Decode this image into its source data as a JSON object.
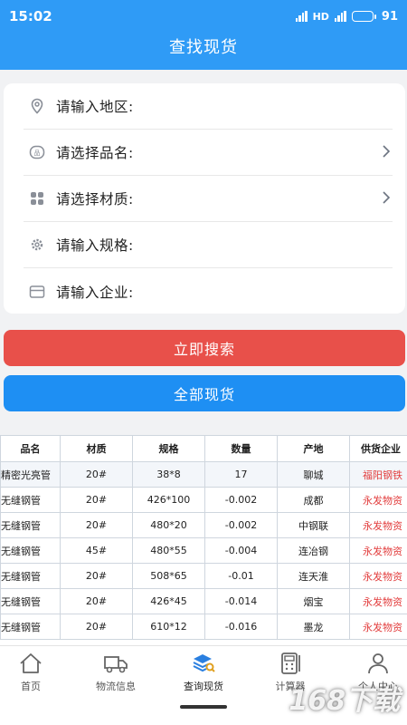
{
  "status": {
    "time": "15:02",
    "battery": "91"
  },
  "header": {
    "title": "查找现货"
  },
  "form": {
    "region": "请输入地区:",
    "product": "请选择品名:",
    "material": "请选择材质:",
    "spec": "请输入规格:",
    "company": "请输入企业:"
  },
  "buttons": {
    "search": "立即搜索",
    "all": "全部现货"
  },
  "table": {
    "headers": [
      "品名",
      "材质",
      "规格",
      "数量",
      "产地",
      "供货企业"
    ],
    "rows": [
      [
        "精密光亮管",
        "20#",
        "38*8",
        "17",
        "聊城",
        "福阳钢铁"
      ],
      [
        "无缝钢管",
        "20#",
        "426*100",
        "-0.002",
        "成都",
        "永发物资"
      ],
      [
        "无缝钢管",
        "20#",
        "480*20",
        "-0.002",
        "中钢联",
        "永发物资"
      ],
      [
        "无缝钢管",
        "45#",
        "480*55",
        "-0.004",
        "连冶钢",
        "永发物资"
      ],
      [
        "无缝钢管",
        "20#",
        "508*65",
        "-0.01",
        "连天淮",
        "永发物资"
      ],
      [
        "无缝钢管",
        "20#",
        "426*45",
        "-0.014",
        "烟宝",
        "永发物资"
      ],
      [
        "无缝钢管",
        "20#",
        "610*12",
        "-0.016",
        "墨龙",
        "永发物资"
      ]
    ]
  },
  "tabs": {
    "home": "首页",
    "logistics": "物流信息",
    "query": "查询现货",
    "calculator": "计算器",
    "profile": "个人中心"
  },
  "watermark": "168下载",
  "colors": {
    "primary": "#2f9bf6",
    "search_btn": "#e8504a",
    "all_btn": "#1e8ff3",
    "company_text": "#e23c3c"
  }
}
